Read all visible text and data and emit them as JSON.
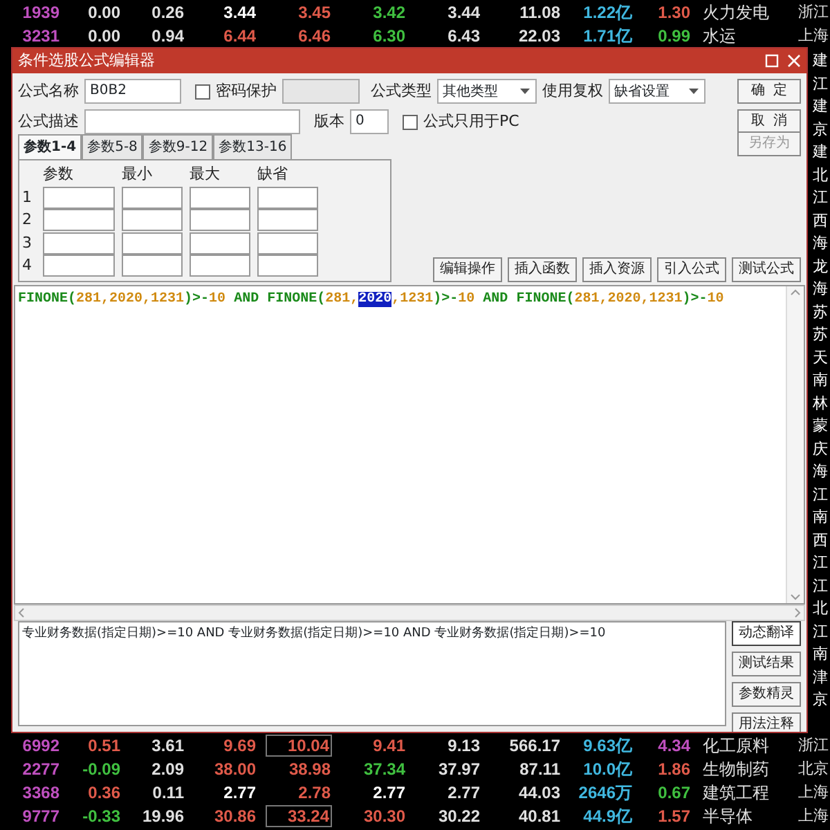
{
  "quotes_top": [
    {
      "cells": [
        {
          "text": "1939",
          "color": "#c050c0",
          "boxed": false
        },
        {
          "text": "0.00",
          "color": "#e0e0e0",
          "boxed": false
        },
        {
          "text": "0.26",
          "color": "#e0e0e0",
          "boxed": false
        },
        {
          "text": "3.44",
          "color": "#ffffff",
          "boxed": false
        },
        {
          "text": "3.45",
          "color": "#e05a4a",
          "boxed": false
        },
        {
          "text": "3.42",
          "color": "#40c040",
          "boxed": false
        },
        {
          "text": "3.44",
          "color": "#e0e0e0",
          "boxed": false
        },
        {
          "text": "11.08",
          "color": "#e0e0e0",
          "boxed": false
        },
        {
          "text": "1.22亿",
          "color": "#40b8e0",
          "boxed": false
        },
        {
          "text": "1.30",
          "color": "#e05a4a",
          "boxed": false
        },
        {
          "text": "火力发电",
          "color": "#e0e0e0",
          "boxed": false
        },
        {
          "text": "浙江",
          "color": "#e0e0e0",
          "boxed": false
        }
      ]
    },
    {
      "cells": [
        {
          "text": "3231",
          "color": "#c050c0",
          "boxed": false
        },
        {
          "text": "0.00",
          "color": "#e0e0e0",
          "boxed": false
        },
        {
          "text": "0.94",
          "color": "#e0e0e0",
          "boxed": false
        },
        {
          "text": "6.44",
          "color": "#e05a4a",
          "boxed": false
        },
        {
          "text": "6.46",
          "color": "#e05a4a",
          "boxed": false
        },
        {
          "text": "6.30",
          "color": "#40c040",
          "boxed": false
        },
        {
          "text": "6.43",
          "color": "#e0e0e0",
          "boxed": false
        },
        {
          "text": "22.03",
          "color": "#e0e0e0",
          "boxed": false
        },
        {
          "text": "1.71亿",
          "color": "#40b8e0",
          "boxed": false
        },
        {
          "text": "0.99",
          "color": "#40c040",
          "boxed": false
        },
        {
          "text": "水运",
          "color": "#e0e0e0",
          "boxed": false
        },
        {
          "text": "上海",
          "color": "#e0e0e0",
          "boxed": false
        }
      ]
    }
  ],
  "side_column": [
    "建",
    "江",
    "建",
    "京",
    "建",
    "北",
    "江",
    "西",
    "海",
    "龙",
    "海",
    "苏",
    "苏",
    "天",
    "南",
    "林",
    "蒙",
    "庆",
    "海",
    "江",
    "南",
    "西",
    "江",
    "江",
    "北",
    "江",
    "南",
    "津",
    "京"
  ],
  "dialog": {
    "title": "条件选股公式编辑器",
    "name_label": "公式名称",
    "name_value": "B0B2",
    "password": {
      "label": "密码保护",
      "checked": false
    },
    "type_label": "公式类型",
    "type_value": "其他类型",
    "adjust_label": "使用复权",
    "adjust_value": "缺省设置",
    "desc_label": "公式描述",
    "version_label": "版本",
    "version_value": "0",
    "pc_only": {
      "label": "公式只用于PC",
      "checked": false
    },
    "side_buttons": [
      {
        "label": "确  定",
        "disabled": false
      },
      {
        "label": "取  消",
        "disabled": false
      },
      {
        "label": "另存为",
        "disabled": true
      }
    ],
    "tabs": [
      {
        "label": "参数1-4",
        "selected": true
      },
      {
        "label": "参数5-8",
        "selected": false
      },
      {
        "label": "参数9-12",
        "selected": false
      },
      {
        "label": "参数13-16",
        "selected": false
      }
    ],
    "param_columns": [
      "参数",
      "最小",
      "最大",
      "缺省"
    ],
    "param_rows": [
      "1",
      "2",
      "3",
      "4"
    ],
    "action_buttons": [
      "编辑操作",
      "插入函数",
      "插入资源",
      "引入公式",
      "测试公式"
    ],
    "formula": [
      {
        "text": "FINONE(",
        "kind": "func",
        "selected": false
      },
      {
        "text": "281,2020,1231",
        "kind": "num",
        "selected": false
      },
      {
        "text": ")>-",
        "kind": "func",
        "selected": false
      },
      {
        "text": "10",
        "kind": "num",
        "selected": false
      },
      {
        "text": " AND ",
        "kind": "func",
        "selected": false
      },
      {
        "text": "FINONE(",
        "kind": "func",
        "selected": false
      },
      {
        "text": "281,",
        "kind": "num",
        "selected": false
      },
      {
        "text": "2020",
        "kind": "num",
        "selected": true
      },
      {
        "text": ",1231",
        "kind": "num",
        "selected": false
      },
      {
        "text": ")>-",
        "kind": "func",
        "selected": false
      },
      {
        "text": "10",
        "kind": "num",
        "selected": false
      },
      {
        "text": " AND ",
        "kind": "func",
        "selected": false
      },
      {
        "text": "FINONE(",
        "kind": "func",
        "selected": false
      },
      {
        "text": "281,2020,1231",
        "kind": "num",
        "selected": false
      },
      {
        "text": ")>-",
        "kind": "func",
        "selected": false
      },
      {
        "text": "10",
        "kind": "num",
        "selected": false
      }
    ],
    "translation": "专业财务数据(指定日期)>=10 AND 专业财务数据(指定日期)>=10 AND 专业财务数据(指定日期)>=10",
    "help_buttons": [
      {
        "label": "动态翻译",
        "selected": true
      },
      {
        "label": "测试结果",
        "selected": false
      },
      {
        "label": "参数精灵",
        "selected": false
      },
      {
        "label": "用法注释",
        "selected": false
      }
    ]
  },
  "quotes_bottom": [
    {
      "cells": [
        {
          "text": "6992",
          "color": "#c050c0",
          "boxed": false
        },
        {
          "text": "0.51",
          "color": "#e05a4a",
          "boxed": false
        },
        {
          "text": "3.61",
          "color": "#e0e0e0",
          "boxed": false
        },
        {
          "text": "9.69",
          "color": "#e05a4a",
          "boxed": false
        },
        {
          "text": "10.04",
          "color": "#e05a4a",
          "boxed": true
        },
        {
          "text": "9.41",
          "color": "#e05a4a",
          "boxed": false
        },
        {
          "text": "9.13",
          "color": "#e0e0e0",
          "boxed": false
        },
        {
          "text": "566.17",
          "color": "#e0e0e0",
          "boxed": false
        },
        {
          "text": "9.63亿",
          "color": "#40b8e0",
          "boxed": false
        },
        {
          "text": "4.34",
          "color": "#c050c0",
          "boxed": false
        },
        {
          "text": "化工原料",
          "color": "#e0e0e0",
          "boxed": false
        },
        {
          "text": "浙江",
          "color": "#e0e0e0",
          "boxed": false
        }
      ]
    },
    {
      "cells": [
        {
          "text": "2277",
          "color": "#c050c0",
          "boxed": false
        },
        {
          "text": "-0.09",
          "color": "#40c040",
          "boxed": false
        },
        {
          "text": "2.09",
          "color": "#e0e0e0",
          "boxed": false
        },
        {
          "text": "38.00",
          "color": "#e05a4a",
          "boxed": false
        },
        {
          "text": "38.98",
          "color": "#e05a4a",
          "boxed": false
        },
        {
          "text": "37.34",
          "color": "#40c040",
          "boxed": false
        },
        {
          "text": "37.97",
          "color": "#e0e0e0",
          "boxed": false
        },
        {
          "text": "87.11",
          "color": "#e0e0e0",
          "boxed": false
        },
        {
          "text": "10.0亿",
          "color": "#40b8e0",
          "boxed": false
        },
        {
          "text": "1.86",
          "color": "#e05a4a",
          "boxed": false
        },
        {
          "text": "生物制药",
          "color": "#e0e0e0",
          "boxed": false
        },
        {
          "text": "北京",
          "color": "#e0e0e0",
          "boxed": false
        }
      ]
    },
    {
      "cells": [
        {
          "text": "3368",
          "color": "#c050c0",
          "boxed": false
        },
        {
          "text": "0.36",
          "color": "#e05a4a",
          "boxed": false
        },
        {
          "text": "0.11",
          "color": "#e0e0e0",
          "boxed": false
        },
        {
          "text": "2.77",
          "color": "#ffffff",
          "boxed": false
        },
        {
          "text": "2.78",
          "color": "#e05a4a",
          "boxed": false
        },
        {
          "text": "2.77",
          "color": "#ffffff",
          "boxed": false
        },
        {
          "text": "2.77",
          "color": "#e0e0e0",
          "boxed": false
        },
        {
          "text": "44.03",
          "color": "#e0e0e0",
          "boxed": false
        },
        {
          "text": "2646万",
          "color": "#40b8e0",
          "boxed": false
        },
        {
          "text": "0.67",
          "color": "#40c040",
          "boxed": false
        },
        {
          "text": "建筑工程",
          "color": "#e0e0e0",
          "boxed": false
        },
        {
          "text": "上海",
          "color": "#e0e0e0",
          "boxed": false
        }
      ]
    },
    {
      "cells": [
        {
          "text": "9777",
          "color": "#c050c0",
          "boxed": false
        },
        {
          "text": "-0.33",
          "color": "#40c040",
          "boxed": false
        },
        {
          "text": "19.96",
          "color": "#e0e0e0",
          "boxed": false
        },
        {
          "text": "30.86",
          "color": "#e05a4a",
          "boxed": false
        },
        {
          "text": "33.24",
          "color": "#e05a4a",
          "boxed": true
        },
        {
          "text": "30.30",
          "color": "#e05a4a",
          "boxed": false
        },
        {
          "text": "30.22",
          "color": "#e0e0e0",
          "boxed": false
        },
        {
          "text": "40.81",
          "color": "#e0e0e0",
          "boxed": false
        },
        {
          "text": "44.9亿",
          "color": "#40b8e0",
          "boxed": false
        },
        {
          "text": "1.57",
          "color": "#e05a4a",
          "boxed": false
        },
        {
          "text": "半导体",
          "color": "#e0e0e0",
          "boxed": false
        },
        {
          "text": "上海",
          "color": "#e0e0e0",
          "boxed": false
        }
      ]
    }
  ]
}
